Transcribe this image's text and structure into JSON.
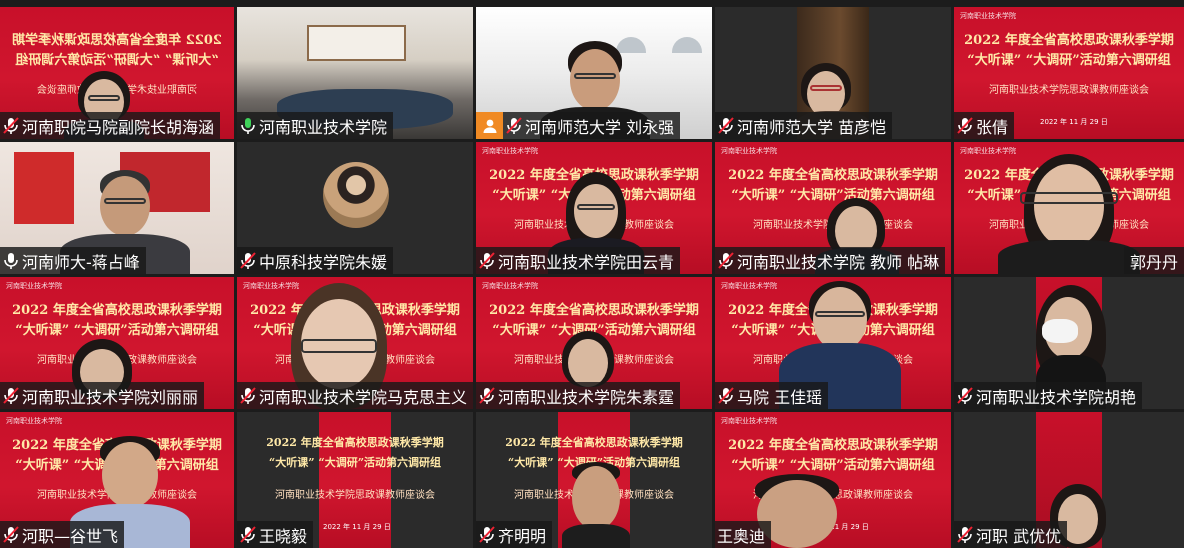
{
  "banner": {
    "line1": "2022 年度全省高校思政课秋季学期",
    "line2": "“大听课” “大调研”活动第六调研组",
    "line3": "河南职业技术学院思政课教师座谈会",
    "date": "2022 年 11 月 29 日",
    "logo": "河南职业技术学院"
  },
  "participants": [
    {
      "name": "河南职院马院副院长胡海涵",
      "mic": "muted"
    },
    {
      "name": "河南职业技术学院",
      "mic": "on"
    },
    {
      "name": "河南师范大学 刘永强",
      "mic": "muted",
      "badge": "person"
    },
    {
      "name": "河南师范大学 苗彦恺",
      "mic": "muted"
    },
    {
      "name": "张倩",
      "mic": "muted"
    },
    {
      "name": "河南师大-蒋占峰",
      "mic": "on"
    },
    {
      "name": "中原科技学院朱媛",
      "mic": "muted"
    },
    {
      "name": "河南职业技术学院田云青",
      "mic": "muted"
    },
    {
      "name": "河南职业技术学院 教师 帖琳",
      "mic": "muted"
    },
    {
      "name": "郭丹丹",
      "mic": "none"
    },
    {
      "name": "河南职业技术学院刘丽丽",
      "mic": "muted"
    },
    {
      "name": "河南职业技术学院马克思主义",
      "mic": "muted"
    },
    {
      "name": "河南职业技术学院朱素霆",
      "mic": "muted"
    },
    {
      "name": "马院 王佳瑶",
      "mic": "muted"
    },
    {
      "name": "河南职业技术学院胡艳",
      "mic": "muted"
    },
    {
      "name": "河职—谷世飞",
      "mic": "muted"
    },
    {
      "name": "王晓毅",
      "mic": "muted"
    },
    {
      "name": "齐明明",
      "mic": "muted"
    },
    {
      "name": "王奥迪",
      "mic": "none"
    },
    {
      "name": "河职 武优优",
      "mic": "muted"
    }
  ],
  "colors": {
    "active_border": "#3fd35a",
    "banner_red": "#c8102a",
    "label_bg": "#191919",
    "badge": "#f08a24"
  },
  "icons": {
    "muted": "mic-muted-icon",
    "on": "mic-icon",
    "person": "person-icon"
  }
}
